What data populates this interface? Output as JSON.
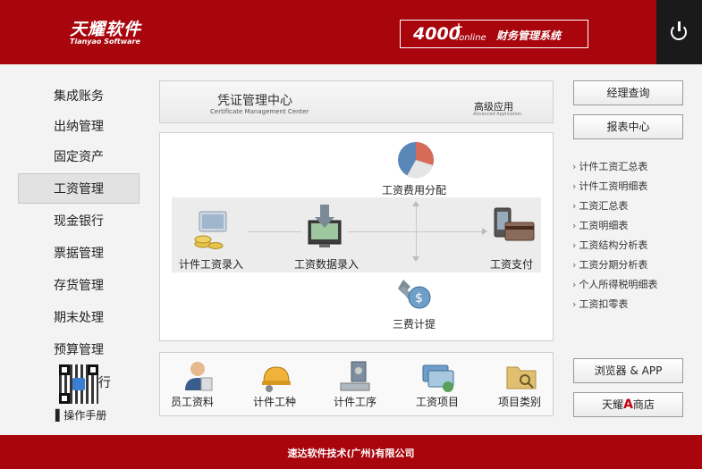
{
  "header": {
    "logo_cn": "天耀软件",
    "logo_en": "Tianyao Software",
    "product_number": "4000",
    "product_plus": "+",
    "product_online": ".online",
    "product_name": "财务管理系统"
  },
  "sidebar": {
    "items": [
      {
        "label": "集成账务"
      },
      {
        "label": "出纳管理"
      },
      {
        "label": "固定资产"
      },
      {
        "label": "工资管理",
        "active": true
      },
      {
        "label": "现金银行"
      },
      {
        "label": "票据管理"
      },
      {
        "label": "存货管理"
      },
      {
        "label": "期末处理"
      },
      {
        "label": "预算管理"
      }
    ],
    "qr_side_text": "行",
    "manual_label": "操作手册"
  },
  "banner": {
    "title": "凭证管理中心",
    "subtitle": "Certificate Management Center",
    "advanced": "高级应用",
    "advanced_sub": "Advanced Application"
  },
  "flow": {
    "piece_entry": "计件工资录入",
    "data_entry": "工资数据录入",
    "cost_allocation": "工资费用分配",
    "payment": "工资支付",
    "three_fees": "三费计提"
  },
  "tools": [
    {
      "label": "员工资料",
      "icon": "employee-icon"
    },
    {
      "label": "计件工种",
      "icon": "worker-helmet-icon"
    },
    {
      "label": "计件工序",
      "icon": "process-icon"
    },
    {
      "label": "工资项目",
      "icon": "salary-item-icon"
    },
    {
      "label": "项目类别",
      "icon": "folder-icon"
    }
  ],
  "right": {
    "manager_query": "经理查询",
    "report_center": "报表中心",
    "reports": [
      "计件工资汇总表",
      "计件工资明细表",
      "工资汇总表",
      "工资明细表",
      "工资结构分析表",
      "工资分期分析表",
      "个人所得税明细表",
      "工资扣零表"
    ],
    "browser_app": "浏览器 & APP",
    "store_prefix": "天耀",
    "store_a": "A",
    "store_suffix": "商店"
  },
  "footer": {
    "company": "速达软件技术(广州)有限公司"
  },
  "colors": {
    "brand_red": "#a8050d",
    "dark": "#1a1a1a"
  }
}
